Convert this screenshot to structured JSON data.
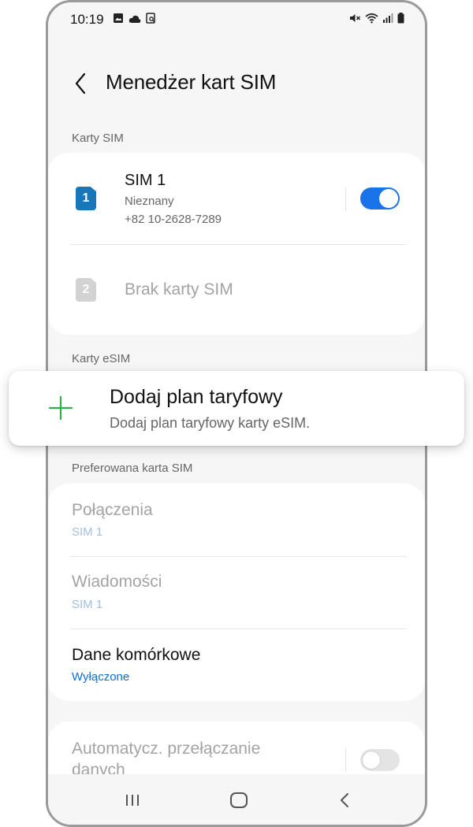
{
  "status_bar": {
    "time": "10:19",
    "left_icons": [
      "gallery-icon",
      "cloud-icon",
      "screenshot-icon"
    ],
    "right_icons": [
      "mute-icon",
      "wifi-icon",
      "signal-icon",
      "battery-icon"
    ]
  },
  "header": {
    "back_icon": "chevron-left-icon",
    "title": "Menedżer kart SIM"
  },
  "sim_cards_section": {
    "label": "Karty SIM",
    "sim1": {
      "slot_number": "1",
      "name": "SIM 1",
      "carrier": "Nieznany",
      "phone": "+82 10-2628-7289",
      "enabled": true
    },
    "sim2": {
      "slot_number": "2",
      "label": "Brak karty SIM"
    }
  },
  "esim_section": {
    "label": "Karty eSIM",
    "add_plan": {
      "icon": "plus-icon",
      "title": "Dodaj plan taryfowy",
      "subtitle": "Dodaj plan taryfowy karty eSIM."
    }
  },
  "preferred_section": {
    "label": "Preferowana karta SIM",
    "calls": {
      "title": "Połączenia",
      "value": "SIM 1"
    },
    "messages": {
      "title": "Wiadomości",
      "value": "SIM 1"
    },
    "mobile_data": {
      "title": "Dane komórkowe",
      "value": "Wyłączone"
    }
  },
  "auto_switch": {
    "title_line1": "Automatycz. przełączanie",
    "title_line2": "danych",
    "enabled": false
  },
  "nav_bar": {
    "recents_icon": "recents-icon",
    "home_icon": "home-icon",
    "back_icon": "nav-back-icon"
  },
  "colors": {
    "accent": "#1a73e8",
    "sim1_blue": "#1976b8",
    "disabled_text": "#a3a3a3",
    "disabled_sub": "#9dbfe6",
    "link_blue": "#0a6fd6",
    "plus_green": "#2fae4a"
  }
}
